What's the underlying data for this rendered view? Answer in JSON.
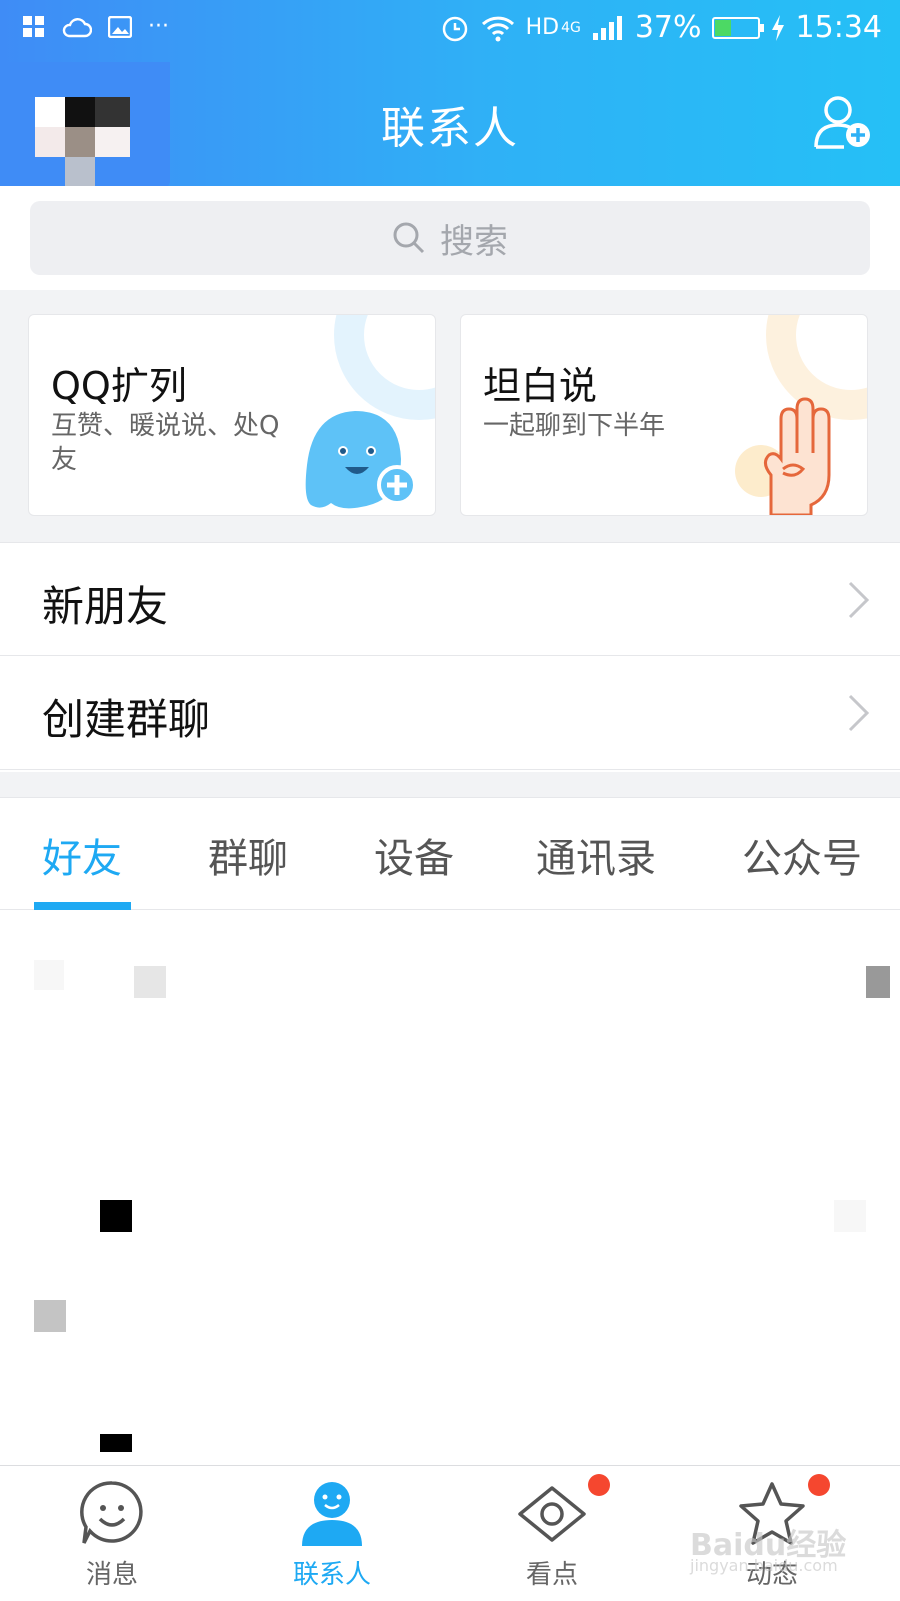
{
  "status_bar": {
    "left_icons": [
      "app-grid-icon",
      "cloud-icon",
      "image-icon",
      "more-dots-icon"
    ],
    "more": "···",
    "alarm_icon": "alarm-icon",
    "wifi_icon": "wifi-icon",
    "network": "HD",
    "network_gen": "4G",
    "battery": "37%",
    "battery_level": 0.37,
    "time": "15:34"
  },
  "header": {
    "title": "联系人",
    "add_contact_icon": "add-user-icon"
  },
  "search": {
    "placeholder": "搜索"
  },
  "cards": [
    {
      "title": "QQ扩列",
      "subtitle": "互赞、暖说说、处Q友",
      "icon": "blue-ghost-plus-icon"
    },
    {
      "title": "坦白说",
      "subtitle": "一起聊到下半年",
      "icon": "hand-gesture-icon"
    }
  ],
  "rows": [
    {
      "label": "新朋友"
    },
    {
      "label": "创建群聊"
    }
  ],
  "tabs": [
    {
      "label": "好友",
      "active": true
    },
    {
      "label": "群聊",
      "active": false
    },
    {
      "label": "设备",
      "active": false
    },
    {
      "label": "通讯录",
      "active": false
    },
    {
      "label": "公众号",
      "active": false
    }
  ],
  "bottom_nav": [
    {
      "label": "消息",
      "icon": "smile-bubble-icon",
      "active": false,
      "badge": false
    },
    {
      "label": "联系人",
      "icon": "contact-person-icon",
      "active": true,
      "badge": false
    },
    {
      "label": "看点",
      "icon": "eye-icon",
      "active": false,
      "badge": true
    },
    {
      "label": "动态",
      "icon": "star-icon",
      "active": false,
      "badge": true
    }
  ],
  "watermark": {
    "brand": "Baidu经验",
    "url": "jingyan.baidu.com"
  },
  "colors": {
    "accent": "#1ea9f3",
    "header_start": "#3f8cf6",
    "header_end": "#25c0f6",
    "badge": "#f5472f"
  }
}
